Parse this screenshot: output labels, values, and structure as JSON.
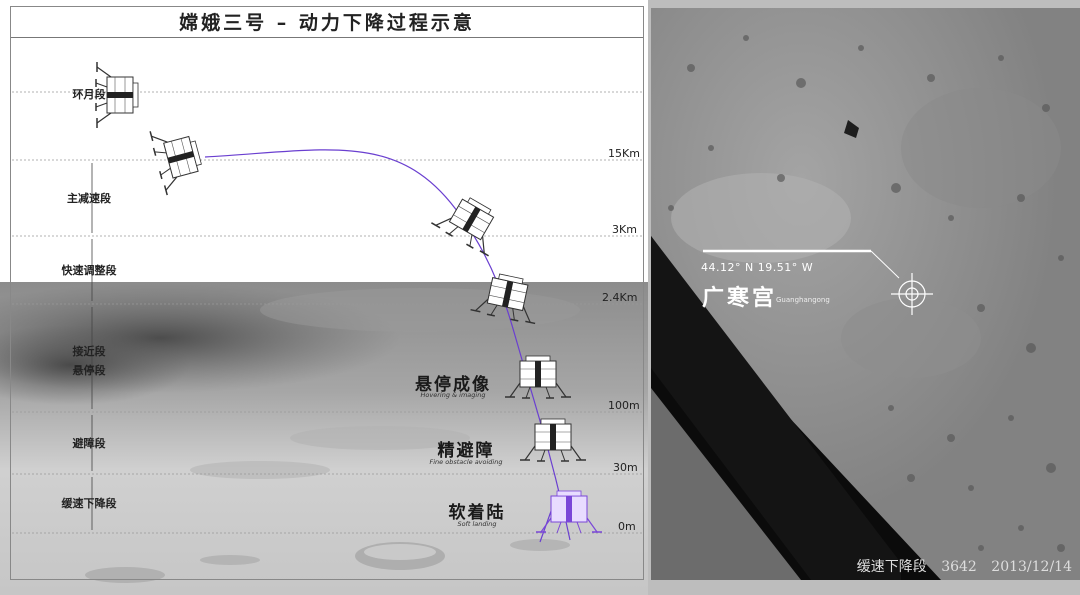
{
  "title": "嫦娥三号 – 动力下降过程示意",
  "phases": [
    {
      "label": "环月段"
    },
    {
      "label": "主减速段"
    },
    {
      "label": "快速调整段"
    },
    {
      "label": "接近段"
    },
    {
      "label": "悬停段"
    },
    {
      "label": "避障段"
    },
    {
      "label": "缓速下降段"
    }
  ],
  "altitudes": [
    "15Km",
    "3Km",
    "2.4Km",
    "100m",
    "30m",
    "0m"
  ],
  "stages": {
    "hover": {
      "cn": "悬停成像",
      "en": "Hovering & imaging"
    },
    "avoid": {
      "cn": "精避障",
      "en": "Fine obstacle avoiding"
    },
    "land": {
      "cn": "软着陆",
      "en": "Soft landing"
    }
  },
  "colors": {
    "trajectory": "#6a3fd0",
    "landed_lander": "#7a46d8"
  },
  "photo": {
    "coords": "44.12° N  19.51° W",
    "site_cn": "广寒宫",
    "site_en": "Guanghangong",
    "caption_phase": "缓速下降段",
    "caption_frame": "3642",
    "caption_date": "2013/12/14"
  },
  "icons": [
    "lander-icon",
    "crosshair-icon"
  ]
}
